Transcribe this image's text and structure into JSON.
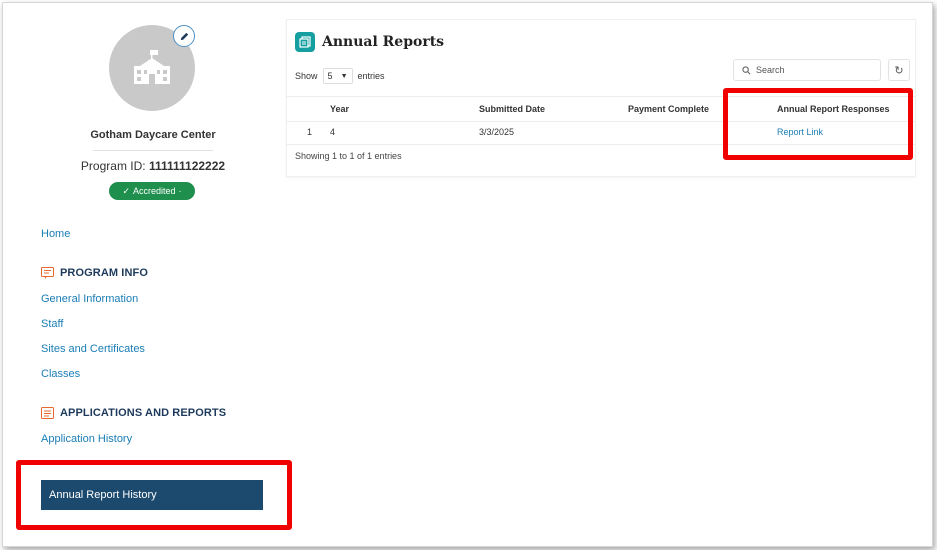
{
  "sidebar": {
    "org_name": "Gotham Daycare Center",
    "program_id_label": "Program ID:",
    "program_id_value": "111111122222",
    "badge_label": "Accredited",
    "home": "Home",
    "program_info": {
      "title": "PROGRAM INFO",
      "items": [
        "General Information",
        "Staff",
        "Sites and Certificates",
        "Classes"
      ]
    },
    "applications": {
      "title": "APPLICATIONS AND REPORTS",
      "items": [
        "Application History"
      ],
      "active_item": "Annual Report History"
    }
  },
  "main": {
    "title": "Annual Reports",
    "show_label": "Show",
    "entries_value": "5",
    "entries_label": "entries",
    "search_placeholder": "Search",
    "columns": [
      "Year",
      "Submitted Date",
      "Payment Complete",
      "Annual Report Responses"
    ],
    "rows": [
      {
        "index": "1",
        "year": "4",
        "submitted_date": "3/3/2025",
        "payment_complete": "",
        "response_link": "Report Link"
      }
    ],
    "showing_text": "Showing 1 to 1 of 1 entries"
  },
  "colors": {
    "accent_teal": "#159fa0",
    "link_blue": "#1a7db5",
    "nav_active": "#1c4a6e",
    "badge_green": "#1f8f4e",
    "highlight_red": "#f00000"
  }
}
